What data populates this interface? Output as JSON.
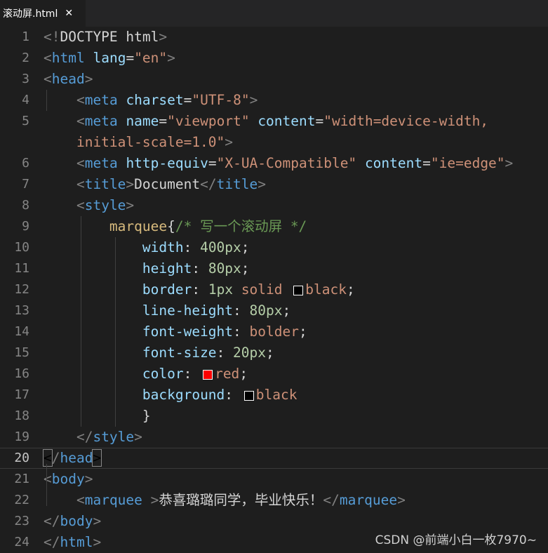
{
  "tab": {
    "title": "滚动屏.html",
    "close_glyph": "✕"
  },
  "watermark": "CSDN @前端小白一枚7970~",
  "swatches": {
    "black": "#000000",
    "red": "#ff0000"
  },
  "lines": [
    {
      "num": "1",
      "segs": [
        [
          "t",
          "<!"
        ],
        [
          "tx",
          "DOCTYPE html"
        ],
        [
          "t",
          ">"
        ]
      ]
    },
    {
      "num": "2",
      "segs": [
        [
          "t",
          "<"
        ],
        [
          "tg",
          "html"
        ],
        [
          "tx",
          " "
        ],
        [
          "at",
          "lang"
        ],
        [
          "tx",
          "="
        ],
        [
          "st",
          "\"en\""
        ],
        [
          "t",
          ">"
        ]
      ]
    },
    {
      "num": "3",
      "segs": [
        [
          "t",
          "<"
        ],
        [
          "tg",
          "head"
        ],
        [
          "t",
          ">"
        ]
      ]
    },
    {
      "num": "4",
      "segs": [
        [
          "tx",
          "    "
        ],
        [
          "t",
          "<"
        ],
        [
          "tg",
          "meta"
        ],
        [
          "tx",
          " "
        ],
        [
          "at",
          "charset"
        ],
        [
          "tx",
          "="
        ],
        [
          "st",
          "\"UTF-8\""
        ],
        [
          "t",
          ">"
        ]
      ]
    },
    {
      "num": "5",
      "segs": [
        [
          "tx",
          "    "
        ],
        [
          "t",
          "<"
        ],
        [
          "tg",
          "meta"
        ],
        [
          "tx",
          " "
        ],
        [
          "at",
          "name"
        ],
        [
          "tx",
          "="
        ],
        [
          "st",
          "\"viewport\""
        ],
        [
          "tx",
          " "
        ],
        [
          "at",
          "content"
        ],
        [
          "tx",
          "="
        ],
        [
          "st",
          "\"width=device-width,"
        ]
      ]
    },
    {
      "num": "",
      "segs": [
        [
          "st",
          "    initial-scale=1.0\""
        ],
        [
          "t",
          ">"
        ]
      ]
    },
    {
      "num": "6",
      "segs": [
        [
          "tx",
          "    "
        ],
        [
          "t",
          "<"
        ],
        [
          "tg",
          "meta"
        ],
        [
          "tx",
          " "
        ],
        [
          "at",
          "http-equiv"
        ],
        [
          "tx",
          "="
        ],
        [
          "st",
          "\"X-UA-Compatible\""
        ],
        [
          "tx",
          " "
        ],
        [
          "at",
          "content"
        ],
        [
          "tx",
          "="
        ],
        [
          "st",
          "\"ie=edge\""
        ],
        [
          "t",
          ">"
        ]
      ]
    },
    {
      "num": "7",
      "segs": [
        [
          "tx",
          "    "
        ],
        [
          "t",
          "<"
        ],
        [
          "tg",
          "title"
        ],
        [
          "t",
          ">"
        ],
        [
          "tx",
          "Document"
        ],
        [
          "t",
          "</"
        ],
        [
          "tg",
          "title"
        ],
        [
          "t",
          ">"
        ]
      ]
    },
    {
      "num": "8",
      "segs": [
        [
          "tx",
          "    "
        ],
        [
          "t",
          "<"
        ],
        [
          "tg",
          "style"
        ],
        [
          "t",
          ">"
        ]
      ]
    },
    {
      "num": "9",
      "segs": [
        [
          "tx",
          "        "
        ],
        [
          "sel",
          "marquee"
        ],
        [
          "tx",
          "{"
        ],
        [
          "cm",
          "/* 写一个滚动屏 */"
        ]
      ]
    },
    {
      "num": "10",
      "segs": [
        [
          "tx",
          "            "
        ],
        [
          "pr",
          "width"
        ],
        [
          "tx",
          ": "
        ],
        [
          "nu",
          "400px"
        ],
        [
          "tx",
          ";"
        ]
      ]
    },
    {
      "num": "11",
      "segs": [
        [
          "tx",
          "            "
        ],
        [
          "pr",
          "height"
        ],
        [
          "tx",
          ": "
        ],
        [
          "nu",
          "80px"
        ],
        [
          "tx",
          ";"
        ]
      ]
    },
    {
      "num": "12",
      "segs": [
        [
          "tx",
          "            "
        ],
        [
          "pr",
          "border"
        ],
        [
          "tx",
          ": "
        ],
        [
          "nu",
          "1px"
        ],
        [
          "tx",
          " "
        ],
        [
          "kw",
          "solid"
        ],
        [
          "tx",
          " "
        ],
        [
          "sw",
          "black"
        ],
        [
          "kw",
          "black"
        ],
        [
          "tx",
          ";"
        ]
      ]
    },
    {
      "num": "13",
      "segs": [
        [
          "tx",
          "            "
        ],
        [
          "pr",
          "line-height"
        ],
        [
          "tx",
          ": "
        ],
        [
          "nu",
          "80px"
        ],
        [
          "tx",
          ";"
        ]
      ]
    },
    {
      "num": "14",
      "segs": [
        [
          "tx",
          "            "
        ],
        [
          "pr",
          "font-weight"
        ],
        [
          "tx",
          ": "
        ],
        [
          "kw",
          "bolder"
        ],
        [
          "tx",
          ";"
        ]
      ]
    },
    {
      "num": "15",
      "segs": [
        [
          "tx",
          "            "
        ],
        [
          "pr",
          "font-size"
        ],
        [
          "tx",
          ": "
        ],
        [
          "nu",
          "20px"
        ],
        [
          "tx",
          ";"
        ]
      ]
    },
    {
      "num": "16",
      "segs": [
        [
          "tx",
          "            "
        ],
        [
          "pr",
          "color"
        ],
        [
          "tx",
          ": "
        ],
        [
          "sw",
          "red"
        ],
        [
          "kw",
          "red"
        ],
        [
          "tx",
          ";"
        ]
      ]
    },
    {
      "num": "17",
      "segs": [
        [
          "tx",
          "            "
        ],
        [
          "pr",
          "background"
        ],
        [
          "tx",
          ": "
        ],
        [
          "sw",
          "black"
        ],
        [
          "kw",
          "black"
        ]
      ]
    },
    {
      "num": "18",
      "segs": [
        [
          "tx",
          "            }"
        ]
      ]
    },
    {
      "num": "19",
      "segs": [
        [
          "tx",
          "    "
        ],
        [
          "t",
          "</"
        ],
        [
          "tg",
          "style"
        ],
        [
          "t",
          ">"
        ]
      ]
    },
    {
      "num": "20",
      "cur": true,
      "segs": [
        [
          "bm",
          "<"
        ],
        [
          "t",
          "/"
        ],
        [
          "tg",
          "head"
        ],
        [
          "bm",
          ">"
        ]
      ]
    },
    {
      "num": "21",
      "segs": [
        [
          "t",
          "<"
        ],
        [
          "tg",
          "body"
        ],
        [
          "t",
          ">"
        ]
      ]
    },
    {
      "num": "22",
      "segs": [
        [
          "tx",
          "    "
        ],
        [
          "t",
          "<"
        ],
        [
          "tg",
          "marquee"
        ],
        [
          "tx",
          " "
        ],
        [
          "t",
          ">"
        ],
        [
          "tx",
          "恭喜璐璐同学，毕业快乐！"
        ],
        [
          "t",
          "</"
        ],
        [
          "tg",
          "marquee"
        ],
        [
          "t",
          ">"
        ]
      ]
    },
    {
      "num": "23",
      "segs": [
        [
          "t",
          "</"
        ],
        [
          "tg",
          "body"
        ],
        [
          "t",
          ">"
        ]
      ]
    },
    {
      "num": "24",
      "segs": [
        [
          "t",
          "</"
        ],
        [
          "tg",
          "html"
        ],
        [
          "t",
          ">"
        ]
      ]
    }
  ]
}
